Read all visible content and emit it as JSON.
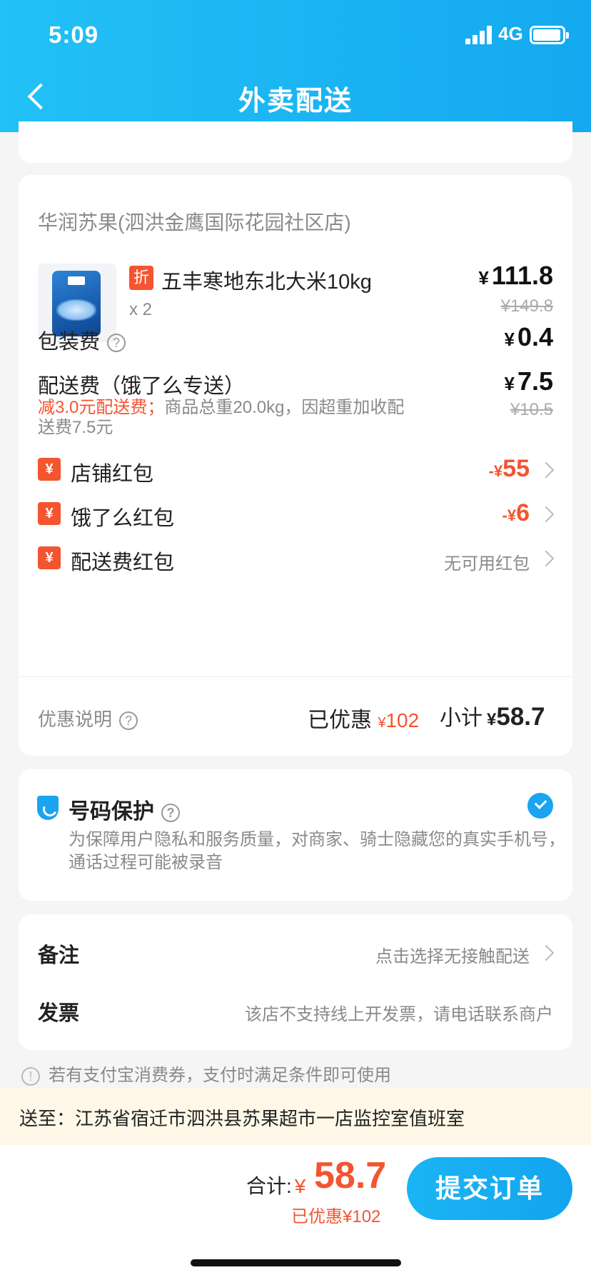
{
  "status_bar": {
    "time": "5:09",
    "network": "4G"
  },
  "header": {
    "title": "外卖配送"
  },
  "order": {
    "shop_name": "华润苏果(泗洪金鹰国际花园社区店)",
    "product": {
      "badge": "折",
      "name": "五丰寒地东北大米10kg",
      "qty": "x 2",
      "price_symbol": "¥",
      "price": "111.8",
      "original_price": "¥149.8"
    },
    "packaging": {
      "label": "包装费",
      "price_symbol": "¥",
      "price": "0.4"
    },
    "delivery": {
      "label": "配送费（饿了么专送）",
      "price_symbol": "¥",
      "price": "7.5",
      "original_price": "¥10.5",
      "note_highlight": "减3.0元配送费；",
      "note_text": "商品总重20.0kg，因超重加收配送费7.5元"
    },
    "coupons": [
      {
        "icon": "¥",
        "label": "店铺红包",
        "prefix": "-¥",
        "value": "55"
      },
      {
        "icon": "¥",
        "label": "饿了么红包",
        "prefix": "-¥",
        "value": "6"
      },
      {
        "icon": "¥",
        "label": "配送费红包",
        "value_text": "无可用红包"
      }
    ],
    "summary": {
      "discount_label": "优惠说明",
      "saved_label": "已优惠",
      "saved_symbol": "¥",
      "saved_value": "102",
      "subtotal_label": "小计",
      "subtotal_symbol": "¥",
      "subtotal_value": "58.7"
    }
  },
  "phone_protection": {
    "title": "号码保护",
    "description": "为保障用户隐私和服务质量，对商家、骑士隐藏您的真实手机号，通话过程可能被录音",
    "checked": true
  },
  "notes": {
    "remark_label": "备注",
    "remark_value": "点击选择无接触配送",
    "invoice_label": "发票",
    "invoice_value": "该店不支持线上开发票，请电话联系商户"
  },
  "alipay_tip": "若有支付宝消费券，支付时满足条件即可使用",
  "address": "送至：江苏省宿迁市泗洪县苏果超市一店监控室值班室",
  "bottom": {
    "total_label": "合计:",
    "total_symbol": "¥",
    "total_value": "58.7",
    "total_saved": "已优惠¥102",
    "submit_label": "提交订单"
  },
  "colors": {
    "accent_blue": "#1ba4ef",
    "accent_red": "#f4542f",
    "address_bg": "#fff8e8"
  }
}
